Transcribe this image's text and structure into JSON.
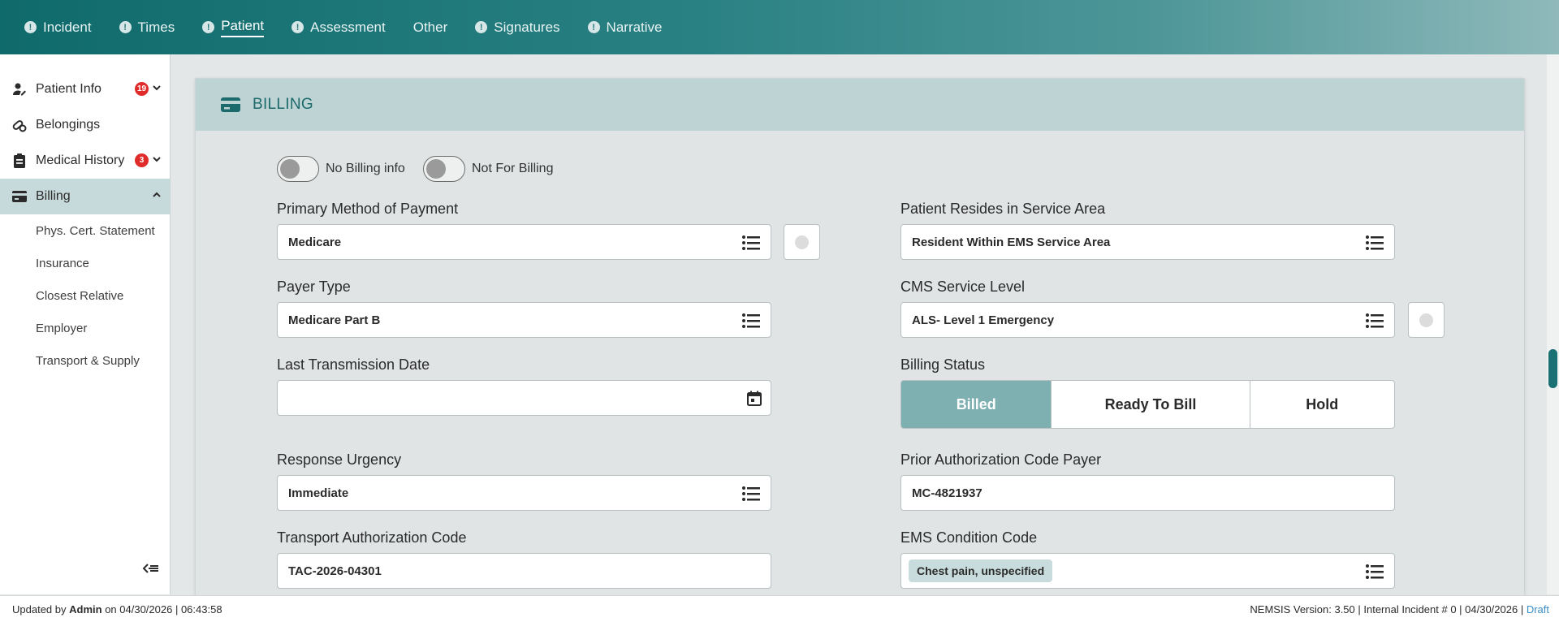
{
  "nav": {
    "tabs": [
      {
        "label": "Incident",
        "warn": true
      },
      {
        "label": "Times",
        "warn": true
      },
      {
        "label": "Patient",
        "warn": true,
        "active": true
      },
      {
        "label": "Assessment",
        "warn": true
      },
      {
        "label": "Other",
        "warn": false
      },
      {
        "label": "Signatures",
        "warn": true
      },
      {
        "label": "Narrative",
        "warn": true
      }
    ],
    "warn_glyph": "!"
  },
  "sidebar": {
    "items": [
      {
        "label": "Patient Info",
        "icon": "user-edit-icon",
        "badge": "19"
      },
      {
        "label": "Belongings",
        "icon": "pills-icon"
      },
      {
        "label": "Medical History",
        "icon": "clipboard-icon",
        "badge": "3"
      },
      {
        "label": "Billing",
        "icon": "credit-card-icon"
      }
    ],
    "subitems": [
      "Phys. Cert. Statement",
      "Insurance",
      "Closest Relative",
      "Employer",
      "Transport & Supply"
    ]
  },
  "billing": {
    "title": "BILLING",
    "toggles": {
      "no_billing": "No Billing info",
      "not_for_billing": "Not For Billing"
    },
    "primary_method": {
      "label": "Primary Method of Payment",
      "value": "Medicare"
    },
    "resides": {
      "label": "Patient Resides in Service Area",
      "value": "Resident Within EMS Service Area"
    },
    "payer_type": {
      "label": "Payer Type",
      "value": "Medicare Part B"
    },
    "cms_level": {
      "label": "CMS Service Level",
      "value": "ALS- Level 1 Emergency"
    },
    "last_transmission": {
      "label": "Last Transmission Date",
      "value": ""
    },
    "billing_status": {
      "label": "Billing Status",
      "options": [
        "Billed",
        "Ready To Bill",
        "Hold"
      ],
      "selected": "Billed"
    },
    "response_urgency": {
      "label": "Response Urgency",
      "value": "Immediate"
    },
    "prior_auth": {
      "label": "Prior Authorization Code Payer",
      "value": "MC-4821937"
    },
    "transport_auth": {
      "label": "Transport Authorization Code",
      "value": "TAC-2026-04301"
    },
    "ems_condition": {
      "label": "EMS Condition Code",
      "value": "Chest pain, unspecified"
    }
  },
  "footer": {
    "updated_prefix": "Updated by",
    "user": "Admin",
    "updated_suffix": "on 04/30/2026 | 06:43:58",
    "right": "NEMSIS Version: 3.50 | Internal Incident # 0 | 04/30/2026 |",
    "status": "Draft"
  },
  "colors": {
    "accent": "#1d6a6c",
    "selected": "#7eb0b2",
    "badge": "#e02b2b"
  }
}
